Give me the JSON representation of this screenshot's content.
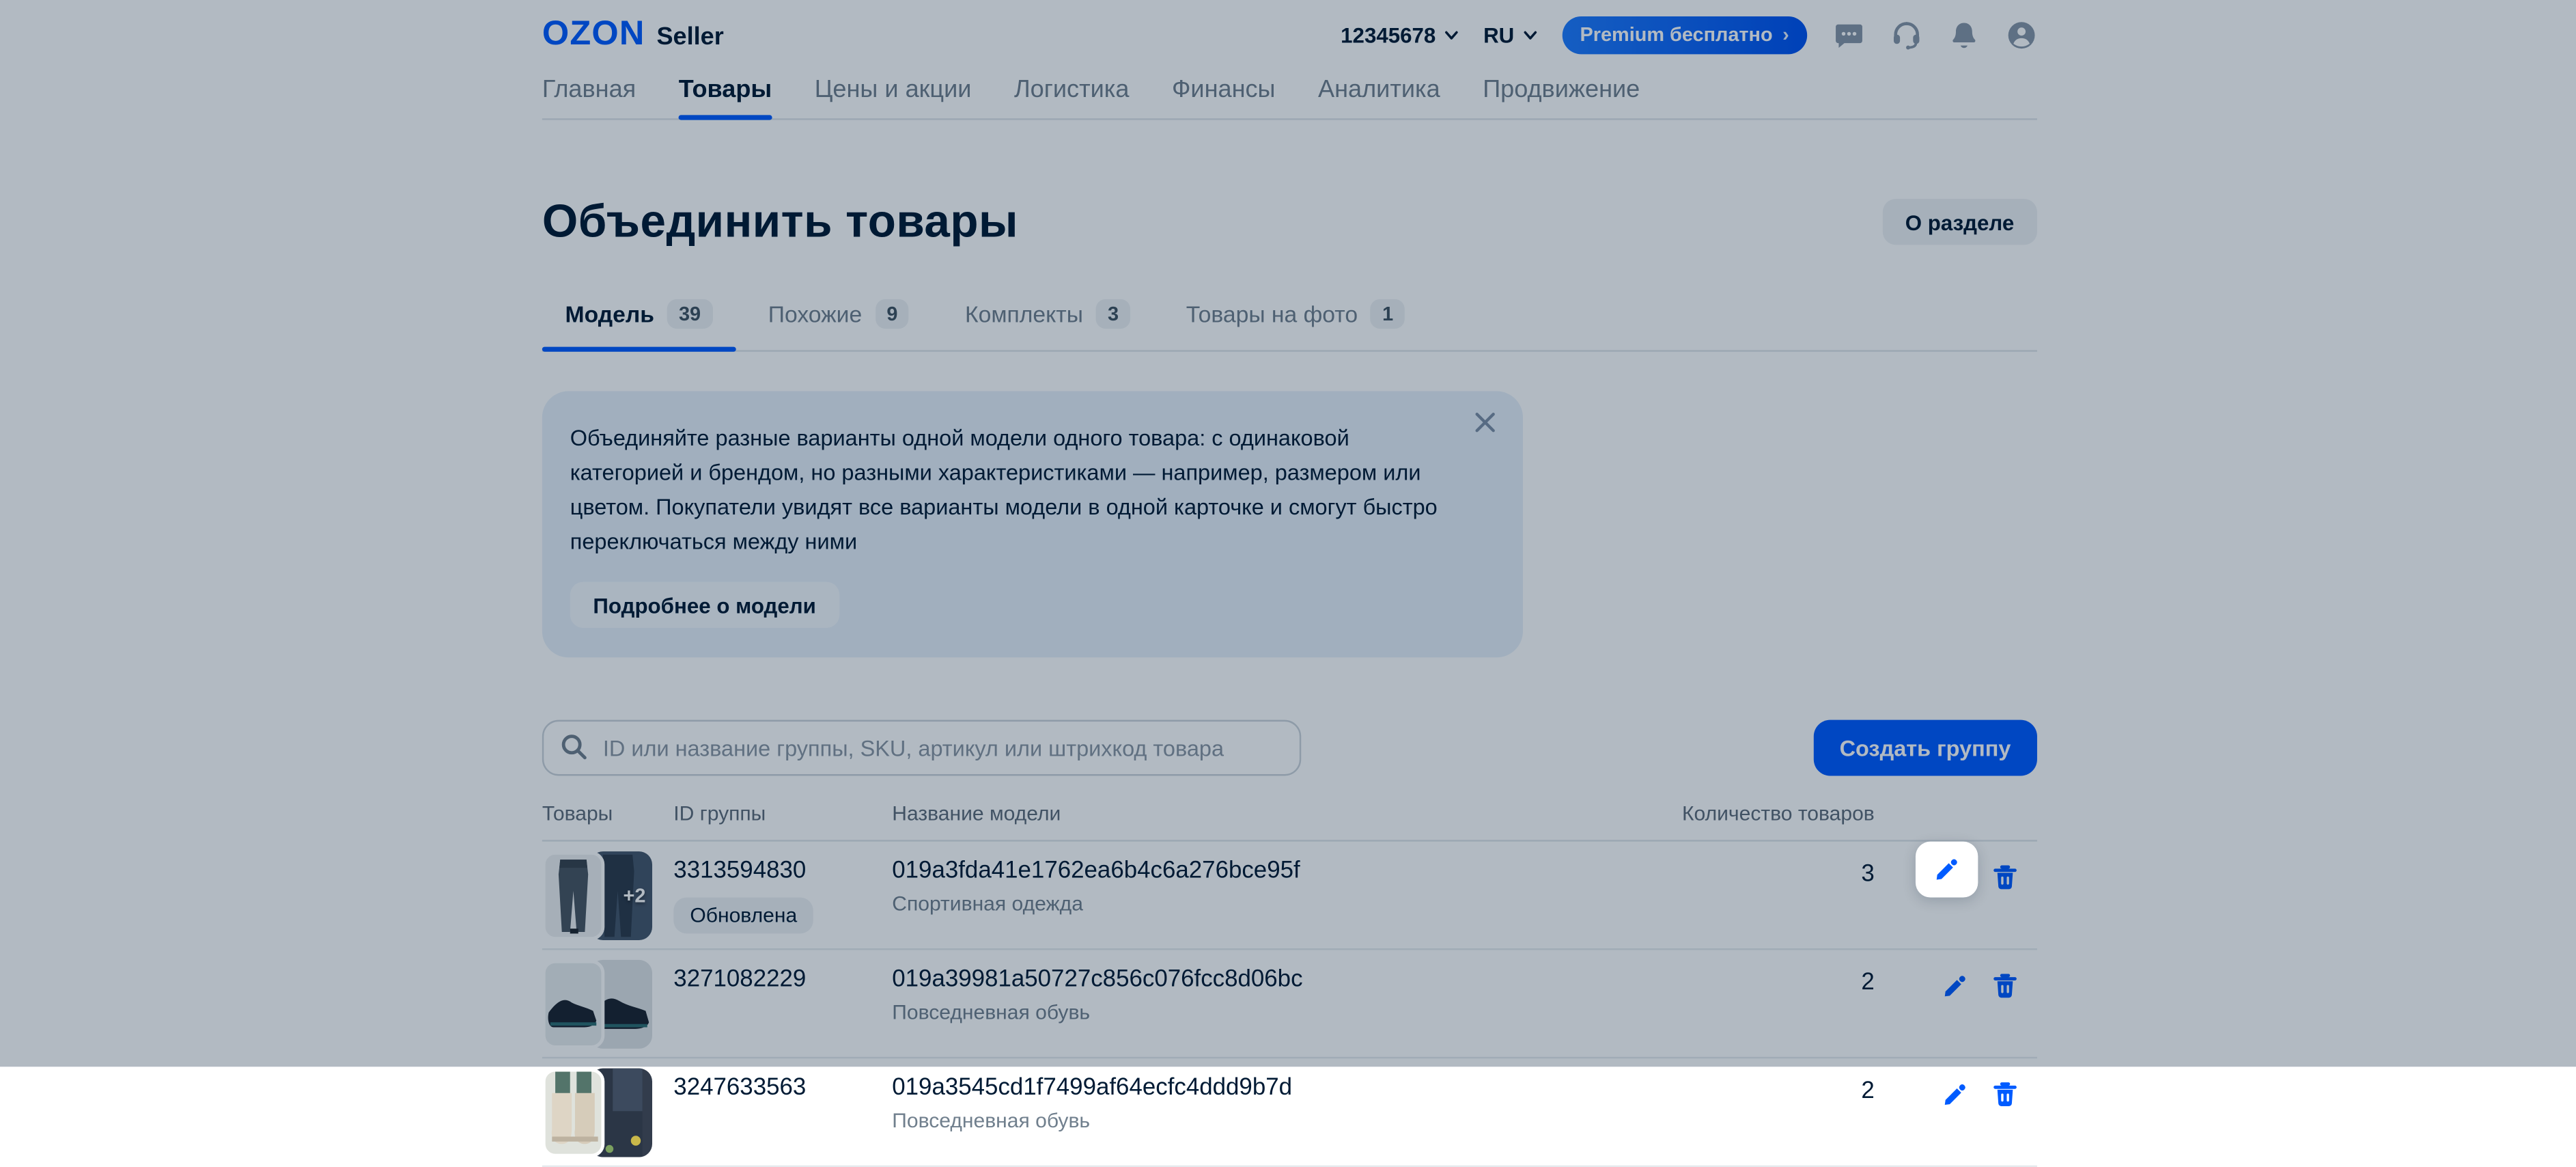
{
  "state": {
    "overlay": "dimmed-spotlight",
    "spotlight_target": "row-1 edit button"
  },
  "colors": {
    "accent_blue": "#005bff",
    "text_dark": "#001a34",
    "text_secondary": "#707f8d",
    "banner_bg": "#e7f0fa",
    "overlay": "rgba(0,26,52,0.30)"
  },
  "header": {
    "logo_brand": "OZON",
    "logo_seller": "Seller",
    "account_id": "12345678",
    "language": "RU",
    "premium_label": "Premium бесплатно",
    "premium_arrow": "›",
    "icons": [
      "chat-icon",
      "support-headset-icon",
      "notifications-bell-icon",
      "profile-icon"
    ]
  },
  "nav": {
    "items": [
      {
        "label": "Главная",
        "active": false
      },
      {
        "label": "Товары",
        "active": true
      },
      {
        "label": "Цены и акции",
        "active": false
      },
      {
        "label": "Логистика",
        "active": false
      },
      {
        "label": "Финансы",
        "active": false
      },
      {
        "label": "Аналитика",
        "active": false
      },
      {
        "label": "Продвижение",
        "active": false
      }
    ]
  },
  "page": {
    "title": "Объединить товары",
    "about_button": "О разделе"
  },
  "tabs": {
    "items": [
      {
        "label": "Модель",
        "count": "39",
        "active": true
      },
      {
        "label": "Похожие",
        "count": "9",
        "active": false
      },
      {
        "label": "Комплекты",
        "count": "3",
        "active": false
      },
      {
        "label": "Товары на фото",
        "count": "1",
        "active": false
      }
    ]
  },
  "banner": {
    "text": "Объединяйте разные варианты одной модели одного товара: с одинаковой категорией и брендом, но разными характеристиками — например, размером или цветом. Покупатели увидят все варианты модели в одной карточке и смогут быстро переключаться между ними",
    "more_label": "Подробнее о модели"
  },
  "toolbar": {
    "search_placeholder": "ID или название группы, SKU, артикул или штрихкод товара",
    "create_label": "Создать группу"
  },
  "table": {
    "columns": [
      "Товары",
      "ID группы",
      "Название модели",
      "Количество товаров"
    ],
    "rows": [
      {
        "id": "3313594830",
        "status_badge": "Обновлена",
        "name": "019a3fda41e1762ea6b4c6a276bce95f",
        "category": "Спортивная одежда",
        "count": "3",
        "thumbnail_more": "+2"
      },
      {
        "id": "3271082229",
        "status_badge": "",
        "name": "019a39981a50727c856c076fcc8d06bc",
        "category": "Повседневная обувь",
        "count": "2",
        "thumbnail_more": ""
      },
      {
        "id": "3247633563",
        "status_badge": "",
        "name": "019a3545cd1f7499af64ecfc4ddd9b7d",
        "category": "Повседневная обувь",
        "count": "2",
        "thumbnail_more": ""
      }
    ]
  }
}
